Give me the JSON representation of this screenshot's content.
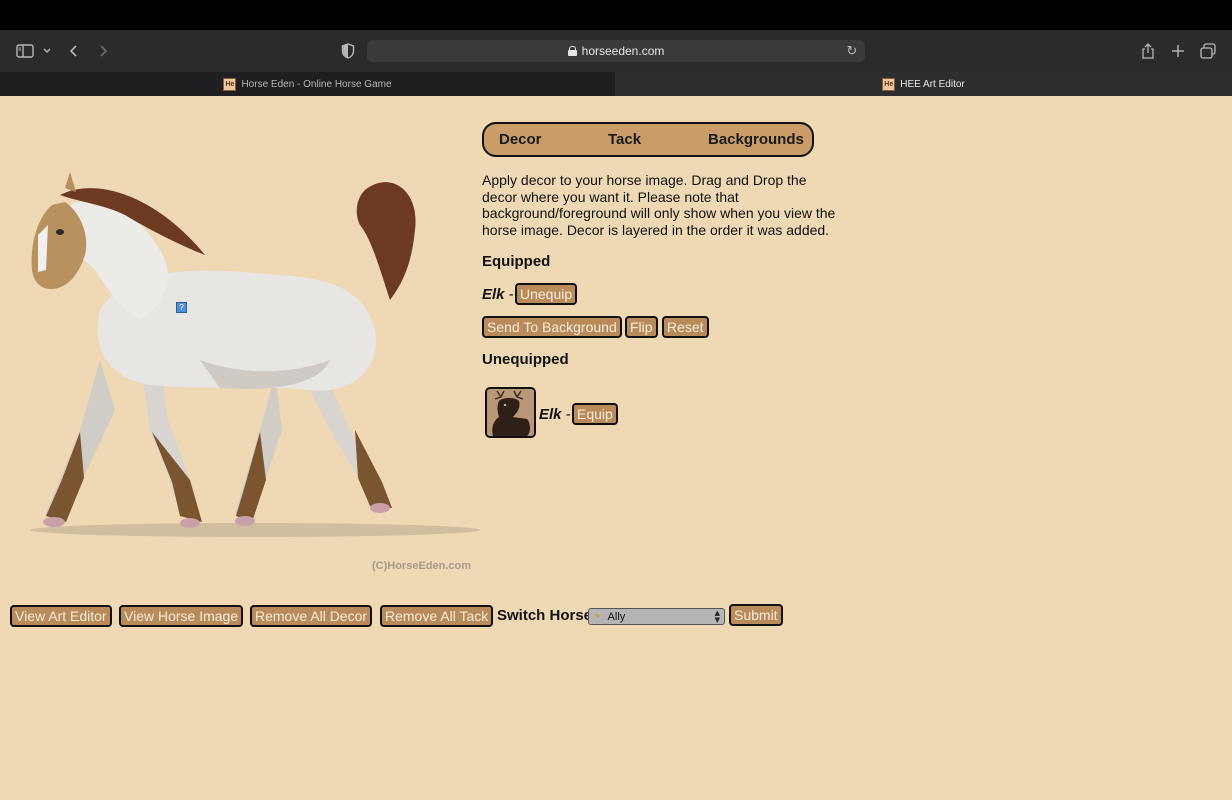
{
  "browser": {
    "url": "horseeden.com",
    "tabs": [
      {
        "title": "Horse Eden - Online Horse Game",
        "active": false
      },
      {
        "title": "HEE Art Editor",
        "active": true
      }
    ],
    "favicon_text": "He"
  },
  "nav_tabs": [
    "Decor",
    "Tack",
    "Backgrounds"
  ],
  "info_text": "Apply decor to your horse image. Drag and Drop the decor where you want it. Please note that background/foreground will only show when you view the horse image. Decor is layered in the order it was added.",
  "equipped": {
    "heading": "Equipped",
    "items": [
      {
        "name": "Elk",
        "separator": "-",
        "action": "Unequip"
      }
    ],
    "controls": [
      "Send To Background",
      "Flip",
      "Reset"
    ]
  },
  "unequipped": {
    "heading": "Unequipped",
    "items": [
      {
        "name": "Elk",
        "separator": "-",
        "action": "Equip",
        "thumbnail_icon": "elk-thumbnail"
      }
    ]
  },
  "horse_image": {
    "copyright": "(C)HorseEden.com",
    "decor_marker": "?"
  },
  "bottom_bar": {
    "buttons": [
      "View Art Editor",
      "View Horse Image",
      "Remove All Decor",
      "Remove All Tack"
    ],
    "switch_label": "Switch Horse",
    "select_value": "Ally",
    "submit_label": "Submit"
  },
  "colors": {
    "page_bg": "#eed9b4",
    "button_bg": "#b98a5a",
    "button_text": "#f7ecd8",
    "tab_pill_bg": "#c99c68"
  }
}
